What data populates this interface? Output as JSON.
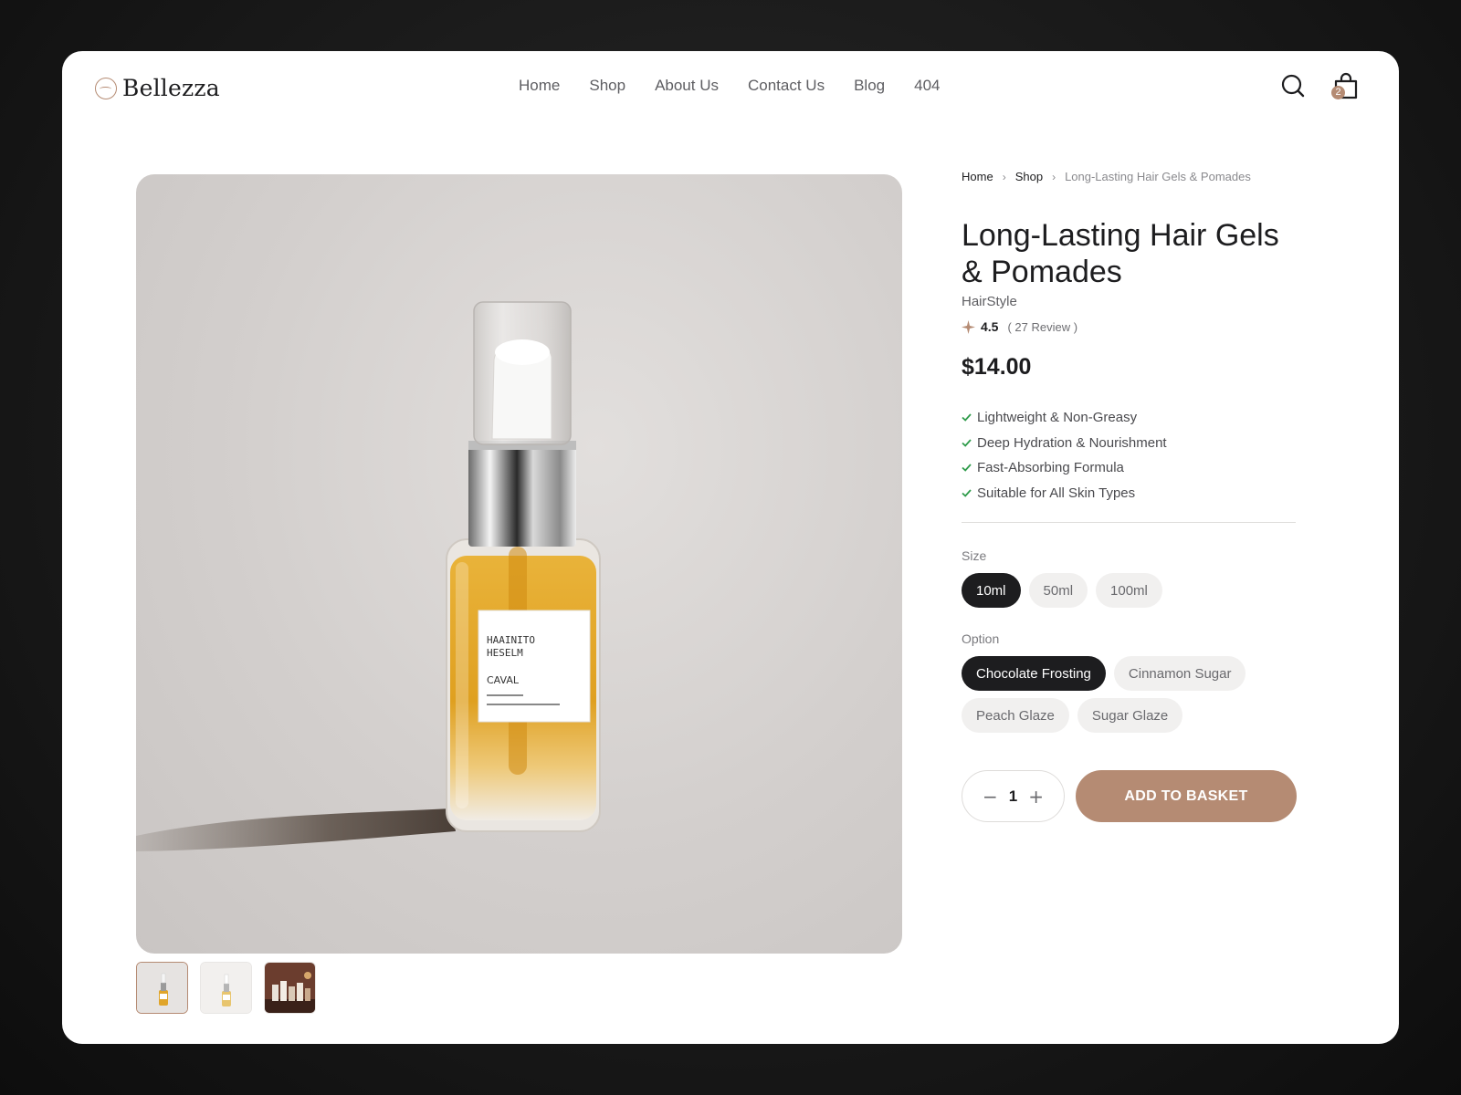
{
  "brand": {
    "name": "Bellezza",
    "accent": "#b58b73"
  },
  "nav": {
    "items": [
      {
        "label": "Home"
      },
      {
        "label": "Shop"
      },
      {
        "label": "About Us"
      },
      {
        "label": "Contact Us"
      },
      {
        "label": "Blog"
      },
      {
        "label": "404"
      }
    ]
  },
  "header": {
    "search_icon": "search-icon",
    "cart_icon": "shopping-bag-icon",
    "cart_count": "2"
  },
  "breadcrumb": {
    "home": "Home",
    "shop": "Shop",
    "current": "Long-Lasting Hair Gels & Pomades"
  },
  "product": {
    "title": "Long-Lasting Hair Gels & Pomades",
    "category": "HairStyle",
    "rating": "4.5",
    "reviews": "( 27 Review )",
    "price": "$14.00",
    "features": [
      "Lightweight & Non-Greasy",
      "Deep Hydration & Nourishment",
      "Fast-Absorbing Formula",
      "Suitable for All Skin Types"
    ],
    "bottle_label": {
      "line1": "HAAINITO",
      "line2": "HESELM",
      "line3": "CAVAL"
    }
  },
  "size": {
    "label": "Size",
    "options": [
      "10ml",
      "50ml",
      "100ml"
    ],
    "selected": "10ml"
  },
  "option": {
    "label": "Option",
    "options": [
      "Chocolate Frosting",
      "Cinnamon Sugar",
      "Peach Glaze",
      "Sugar Glaze"
    ],
    "selected": "Chocolate Frosting"
  },
  "quantity": {
    "value": "1",
    "minus": "−",
    "plus": "+"
  },
  "cta": {
    "add_to_basket": "ADD TO BASKET"
  },
  "thumbnails": {
    "count": 3,
    "selected_index": 0
  }
}
